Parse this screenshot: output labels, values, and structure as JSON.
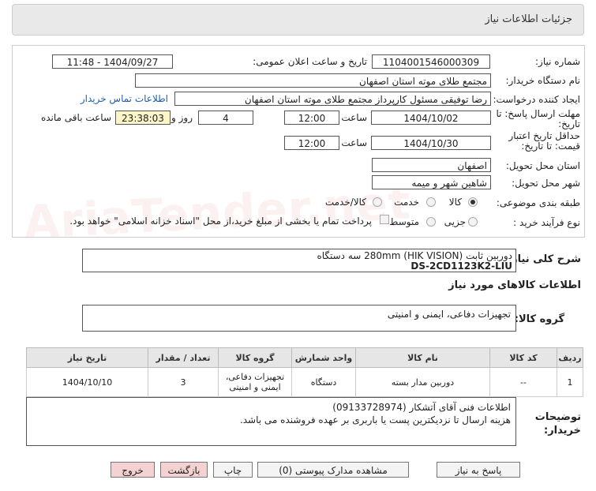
{
  "title": "جزئیات اطلاعات نیاز",
  "watermark": "AriaTender.net",
  "fields": {
    "need_number_label": "شماره نیاز:",
    "need_number": "1104001546000309",
    "announce_label": "تاریخ و ساعت اعلان عمومی:",
    "announce_value": "1404/09/27 - 11:48",
    "buyer_label": "نام دستگاه خریدار:",
    "buyer_value": "مجتمع طلای موته استان اصفهان",
    "creator_label": "ایجاد کننده درخواست:",
    "creator_value": "رضا توفیقی مسئول کارپرداز مجتمع طلای موته استان اصفهان",
    "contact_link": "اطلاعات تماس خریدار",
    "deadline_label": "مهلت ارسال پاسخ: تا تاریخ:",
    "deadline_date": "1404/10/02",
    "time_label": "ساعت",
    "deadline_time": "12:00",
    "days_value": "4",
    "days_label": "روز و",
    "remaining_value": "23:38:03",
    "remaining_label": "ساعت باقی مانده",
    "validity_label": "حداقل تاریخ اعتبار قیمت: تا تاریخ:",
    "validity_date": "1404/10/30",
    "validity_time": "12:00",
    "province_label": "استان محل تحویل:",
    "province_value": "اصفهان",
    "city_label": "شهر محل تحویل:",
    "city_value": "شاهین شهر و میمه",
    "category_label": "طبقه بندی موضوعی:",
    "cat_goods": "کالا",
    "cat_service": "خدمت",
    "cat_goods_service": "کالا/خدمت",
    "process_label": "نوع فرآیند خرید :",
    "proc_partial": "جزیی",
    "proc_medium": "متوسط",
    "payment_note": "پرداخت تمام یا بخشی از مبلغ خرید،از محل \"اسناد خزانه اسلامی\" خواهد بود."
  },
  "general_desc_label": "شرح کلی نیاز:",
  "general_desc_line1": "دوربین ثابت (HIK VISION) 280mm  سه دستگاه",
  "general_desc_line2": "DS-2CD1123K2-LIU",
  "goods_info_title": "اطلاعات کالاهای مورد نیاز",
  "goods_group_label": "گروه کالا:",
  "goods_group_value": "تجهیزات دفاعی، ایمنی و امنیتی",
  "table": {
    "headers": [
      "ردیف",
      "کد کالا",
      "نام کالا",
      "واحد شمارش",
      "گروه کالا",
      "تعداد / مقدار",
      "تاریخ نیاز"
    ],
    "row": [
      "1",
      "--",
      "دوربین مدار بسته",
      "دستگاه",
      "تجهیزات دفاعی، ایمنی و امنیتی",
      "3",
      "1404/10/10"
    ]
  },
  "buyer_notes_label": "توضیحات خریدار:",
  "buyer_notes_line1": "اطلاعات فنی آقای آتشکار (09133728974)",
  "buyer_notes_line2": "هزینه ارسال تا نزدیکترین پست یا باربری بر عهده فروشنده می باشد.",
  "buttons": {
    "reply": "پاسخ به نیاز",
    "attachments": "مشاهده مدارک پیوستی (0)",
    "print": "چاپ",
    "back": "بازگشت",
    "exit": "خروج"
  }
}
